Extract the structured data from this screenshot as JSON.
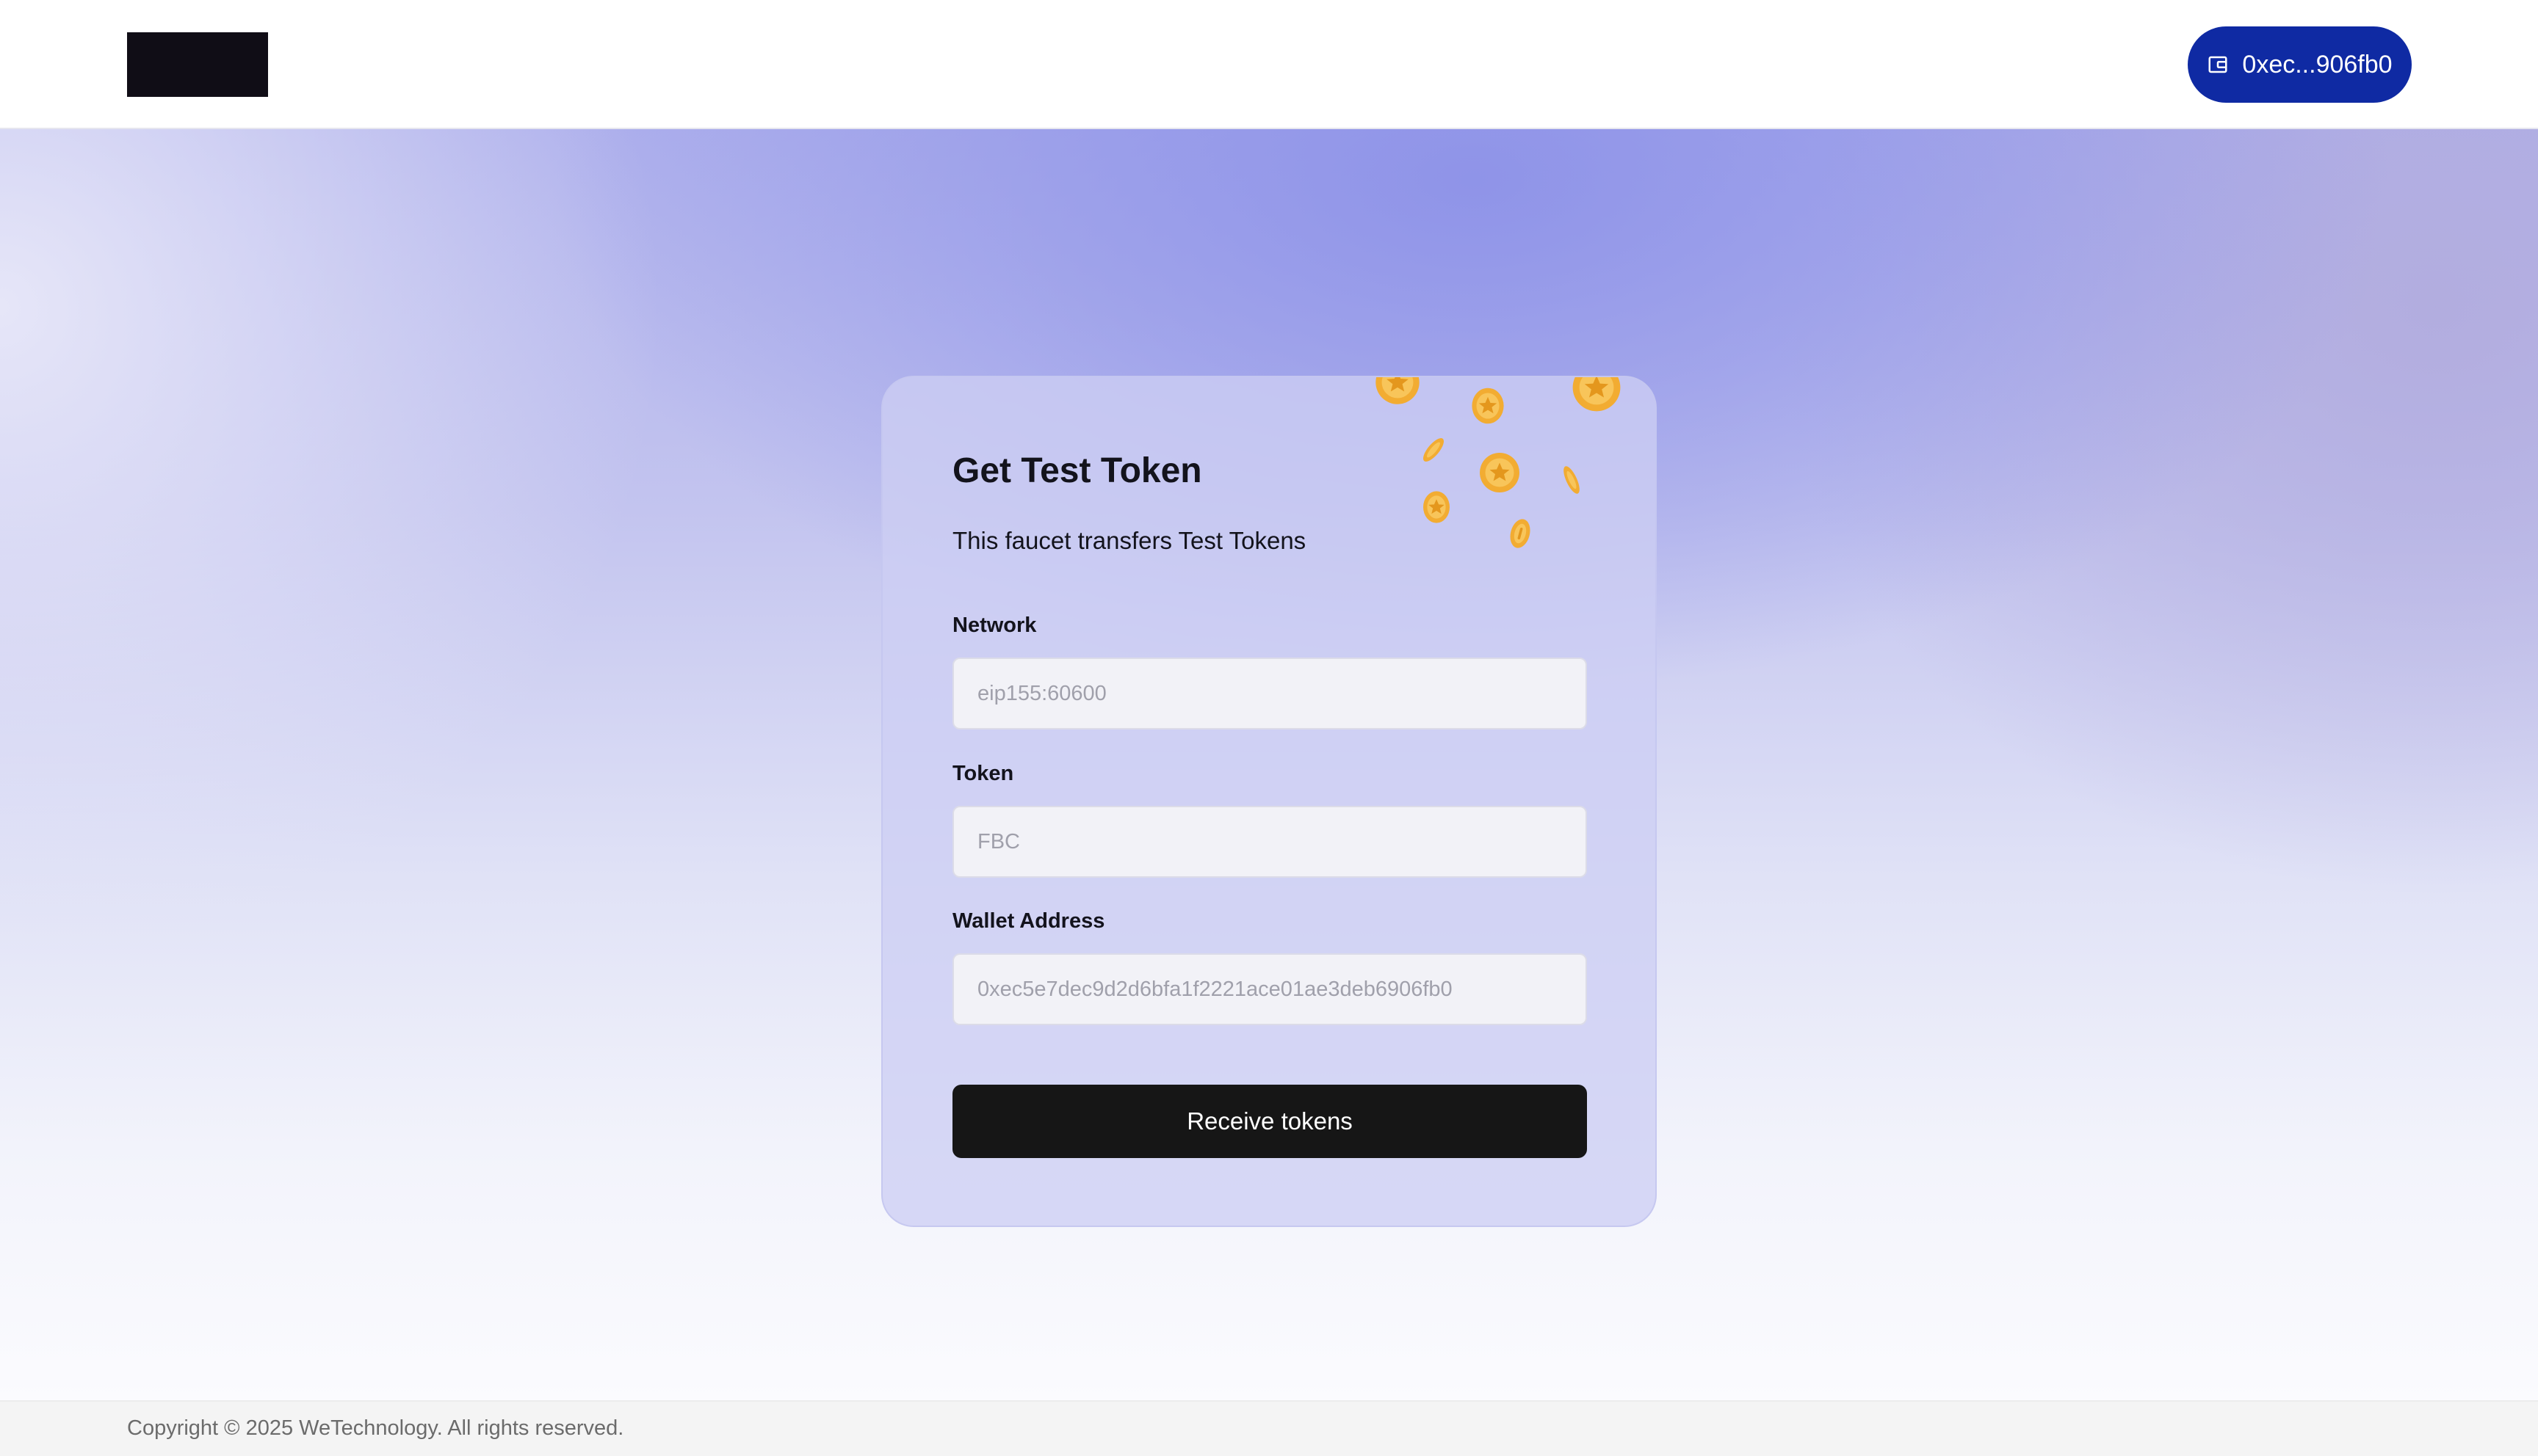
{
  "header": {
    "logo": "",
    "wallet_button": {
      "label": "0xec...906fb0",
      "icon": "wallet-icon"
    }
  },
  "card": {
    "title": "Get Test Token",
    "subtitle": "This faucet transfers Test Tokens",
    "decoration": "gold-coins-illustration",
    "fields": [
      {
        "label": "Network",
        "placeholder": "eip155:60600",
        "value": ""
      },
      {
        "label": "Token",
        "placeholder": "FBC",
        "value": ""
      },
      {
        "label": "Wallet Address",
        "placeholder": "0xec5e7dec9d2d6bfa1f2221ace01ae3deb6906fb0",
        "value": ""
      }
    ],
    "submit_label": "Receive tokens"
  },
  "footer": {
    "copyright": "Copyright © 2025 WeTechnology. All rights reserved."
  },
  "colors": {
    "wallet_button_bg": "#0f2aa3",
    "submit_button_bg": "#161616",
    "coin_gold": "#f4b63f",
    "card_bg": "#cdcef3"
  }
}
